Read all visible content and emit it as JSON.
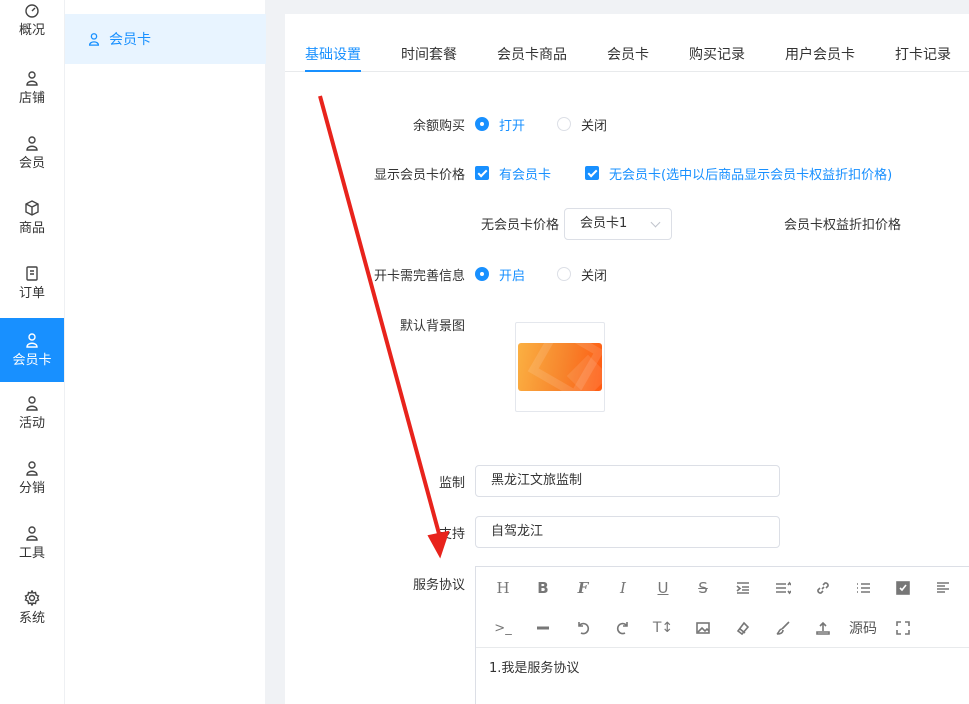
{
  "nav1": {
    "items": [
      {
        "label": "概况",
        "icon": "dashboard-icon"
      },
      {
        "label": "店铺",
        "icon": "user-icon"
      },
      {
        "label": "会员",
        "icon": "user-icon"
      },
      {
        "label": "商品",
        "icon": "box-icon"
      },
      {
        "label": "订单",
        "icon": "clipboard-icon"
      },
      {
        "label": "会员卡",
        "icon": "user-icon"
      },
      {
        "label": "活动",
        "icon": "user-icon"
      },
      {
        "label": "分销",
        "icon": "user-icon"
      },
      {
        "label": "工具",
        "icon": "user-icon"
      },
      {
        "label": "系统",
        "icon": "gear-icon"
      }
    ],
    "active": "会员卡"
  },
  "nav2": {
    "item": "会员卡"
  },
  "tabs": [
    "基础设置",
    "时间套餐",
    "会员卡商品",
    "会员卡",
    "购买记录",
    "用户会员卡",
    "打卡记录"
  ],
  "form": {
    "balance_purchase": {
      "label": "余额购买",
      "on": "打开",
      "off": "关闭"
    },
    "show_price": {
      "label": "显示会员卡价格",
      "opt1": "有会员卡",
      "opt2": "无会员卡(选中以后商品显示会员卡权益折扣价格)"
    },
    "no_card_price": {
      "label": "无会员卡价格",
      "value": "会员卡1",
      "right_label": "会员卡权益折扣价格"
    },
    "require_info": {
      "label": "开卡需完善信息",
      "on": "开启",
      "off": "关闭"
    },
    "default_bg": {
      "label": "默认背景图"
    },
    "supervise": {
      "label": "监制",
      "value": "黑龙江文旅监制"
    },
    "support": {
      "label": "支持",
      "value": "自驾龙江"
    },
    "agreement": {
      "label": "服务协议",
      "source_label": "源码",
      "content": "1.我是服务协议"
    }
  },
  "colors": {
    "accent": "#1890ff",
    "annotation_arrow": "#e8231c"
  }
}
